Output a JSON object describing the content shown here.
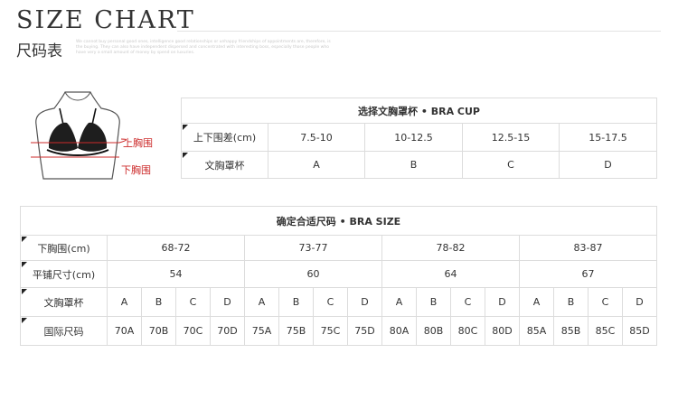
{
  "header": {
    "title": "SIZE CHART",
    "subtitle": "尺码表",
    "blurb": "We cannot buy personal good ones, intelligence good relationships or unhappy friendships of appointments are, therefore, is the buying. They can also have independent dispersed and concentrated with interesting boss, especially those people who have very a small amount of money by spend on luxuries."
  },
  "figure": {
    "upper_bust_label": "上胸围",
    "under_bust_label": "下胸围"
  },
  "cup_table": {
    "title": "选择文胸罩杯 • BRA CUP",
    "row_labels": [
      "上下围差(cm)",
      "文胸罩杯"
    ],
    "differences": [
      "7.5-10",
      "10-12.5",
      "12.5-15",
      "15-17.5"
    ],
    "cups": [
      "A",
      "B",
      "C",
      "D"
    ]
  },
  "size_table": {
    "title": "确定合适尺码 • BRA SIZE",
    "row_labels": [
      "下胸围(cm)",
      "平铺尺寸(cm)",
      "文胸罩杯",
      "国际尺码"
    ],
    "under_bust": [
      "68-72",
      "73-77",
      "78-82",
      "83-87"
    ],
    "flat_size": [
      "54",
      "60",
      "64",
      "67"
    ],
    "cups": [
      "A",
      "B",
      "C",
      "D",
      "A",
      "B",
      "C",
      "D",
      "A",
      "B",
      "C",
      "D",
      "A",
      "B",
      "C",
      "D"
    ],
    "intl_sizes": [
      "70A",
      "70B",
      "70C",
      "70D",
      "75A",
      "75B",
      "75C",
      "75D",
      "80A",
      "80B",
      "80C",
      "80D",
      "85A",
      "85B",
      "85C",
      "85D"
    ]
  }
}
